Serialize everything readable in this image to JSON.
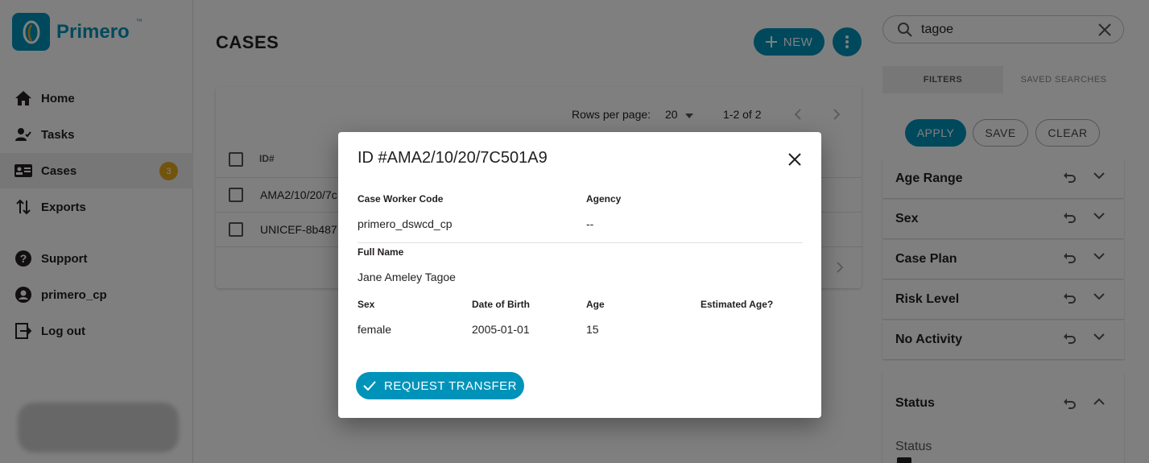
{
  "brand": {
    "name": "Primero",
    "tm": "™",
    "color": "#0093ba"
  },
  "nav": {
    "items": [
      {
        "label": "Home",
        "icon": "home-icon"
      },
      {
        "label": "Tasks",
        "icon": "tasks-icon"
      },
      {
        "label": "Cases",
        "icon": "cases-icon",
        "badge": "3",
        "active": true
      },
      {
        "label": "Exports",
        "icon": "exports-icon"
      },
      {
        "label": "Support",
        "icon": "help-icon"
      },
      {
        "label": "primero_cp",
        "icon": "account-icon"
      },
      {
        "label": "Log out",
        "icon": "logout-icon"
      }
    ]
  },
  "main": {
    "title": "CASES",
    "new_label": "NEW",
    "pager": {
      "rows_label": "Rows per page:",
      "rows_value": "20",
      "range": "1-2 of 2"
    },
    "table": {
      "header_id": "ID#",
      "rows": [
        {
          "id": "AMA2/10/20/7c"
        },
        {
          "id": "UNICEF-8b487"
        }
      ]
    }
  },
  "search": {
    "value": "tagoe"
  },
  "filters": {
    "tab_filters": "FILTERS",
    "tab_saved": "SAVED SEARCHES",
    "apply": "APPLY",
    "save": "SAVE",
    "clear": "CLEAR",
    "panels": [
      "Age Range",
      "Sex",
      "Case Plan",
      "Risk Level",
      "No Activity"
    ],
    "status_title": "Status",
    "status_sub": "Status"
  },
  "dialog": {
    "title": "ID #AMA2/10/20/7C501A9",
    "fields": {
      "case_worker_code": {
        "label": "Case Worker Code",
        "value": "primero_dswcd_cp"
      },
      "agency": {
        "label": "Agency",
        "value": "--"
      },
      "full_name": {
        "label": "Full Name",
        "value": "Jane Ameley Tagoe"
      },
      "sex": {
        "label": "Sex",
        "value": "female"
      },
      "dob": {
        "label": "Date of Birth",
        "value": "2005-01-01"
      },
      "age": {
        "label": "Age",
        "value": "15"
      },
      "estimated_age": {
        "label": "Estimated Age?",
        "value": ""
      }
    },
    "request_transfer": "REQUEST TRANSFER"
  },
  "colors": {
    "primary": "#0093ba",
    "badge": "#e7a81c",
    "overlay": "rgba(0,0,0,0.5)"
  }
}
